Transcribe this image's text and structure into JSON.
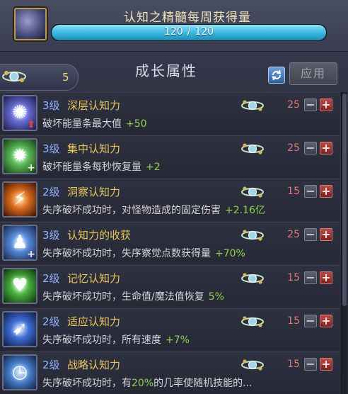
{
  "header": {
    "title": "认知之精髓每周获得量",
    "progress": {
      "current": "120",
      "separator": "/",
      "max": "120",
      "fraction": 1.0
    }
  },
  "toolbar": {
    "points": "5",
    "section_title": "成长属性",
    "refresh_icon": "refresh-icon",
    "apply_label": "应用"
  },
  "colors": {
    "progress_fill": "#3cb9e0",
    "level_text": "#8fb4ff",
    "name_text": "#e8c65a",
    "bonus_text": "#8fd14f",
    "cost_text": "#e07a7a",
    "plus_button": "#b94a47"
  },
  "skills": [
    {
      "level": "3级",
      "name": "深层认知力",
      "desc": "破坏能量条最大值",
      "bonus": "+50",
      "cost": "25",
      "icon": "deep-cognition-icon",
      "badge": "red-arrow"
    },
    {
      "level": "3级",
      "name": "集中认知力",
      "desc": "破坏能量条每秒恢复量",
      "bonus": "+2",
      "cost": "25",
      "icon": "focus-cognition-icon",
      "badge": "plus"
    },
    {
      "level": "2级",
      "name": "洞察认知力",
      "desc": "失序破坏成功时，对怪物造成的固定伤害",
      "bonus": "+2.16亿",
      "cost": "15",
      "icon": "insight-cognition-icon",
      "badge": ""
    },
    {
      "level": "3级",
      "name": "认知力的收获",
      "desc": "失序破坏成功时，失序察觉点数获得量",
      "bonus": "+70%",
      "cost": "25",
      "icon": "harvest-cognition-icon",
      "badge": "plus"
    },
    {
      "level": "2级",
      "name": "记忆认知力",
      "desc": "失序破坏成功时，生命值/魔法值恢复",
      "bonus": "5%",
      "cost": "15",
      "icon": "memory-cognition-icon",
      "badge": ""
    },
    {
      "level": "2级",
      "name": "适应认知力",
      "desc": "失序破坏成功时，所有速度",
      "bonus": "+7%",
      "cost": "15",
      "icon": "adapt-cognition-icon",
      "badge": ""
    },
    {
      "level": "2级",
      "name": "战略认知力",
      "desc_before": "失序破坏成功时，有",
      "desc_highlight": "20%",
      "desc_after": "的几率使随机技能的...",
      "cost": "15",
      "icon": "strategy-cognition-icon",
      "badge": ""
    }
  ]
}
